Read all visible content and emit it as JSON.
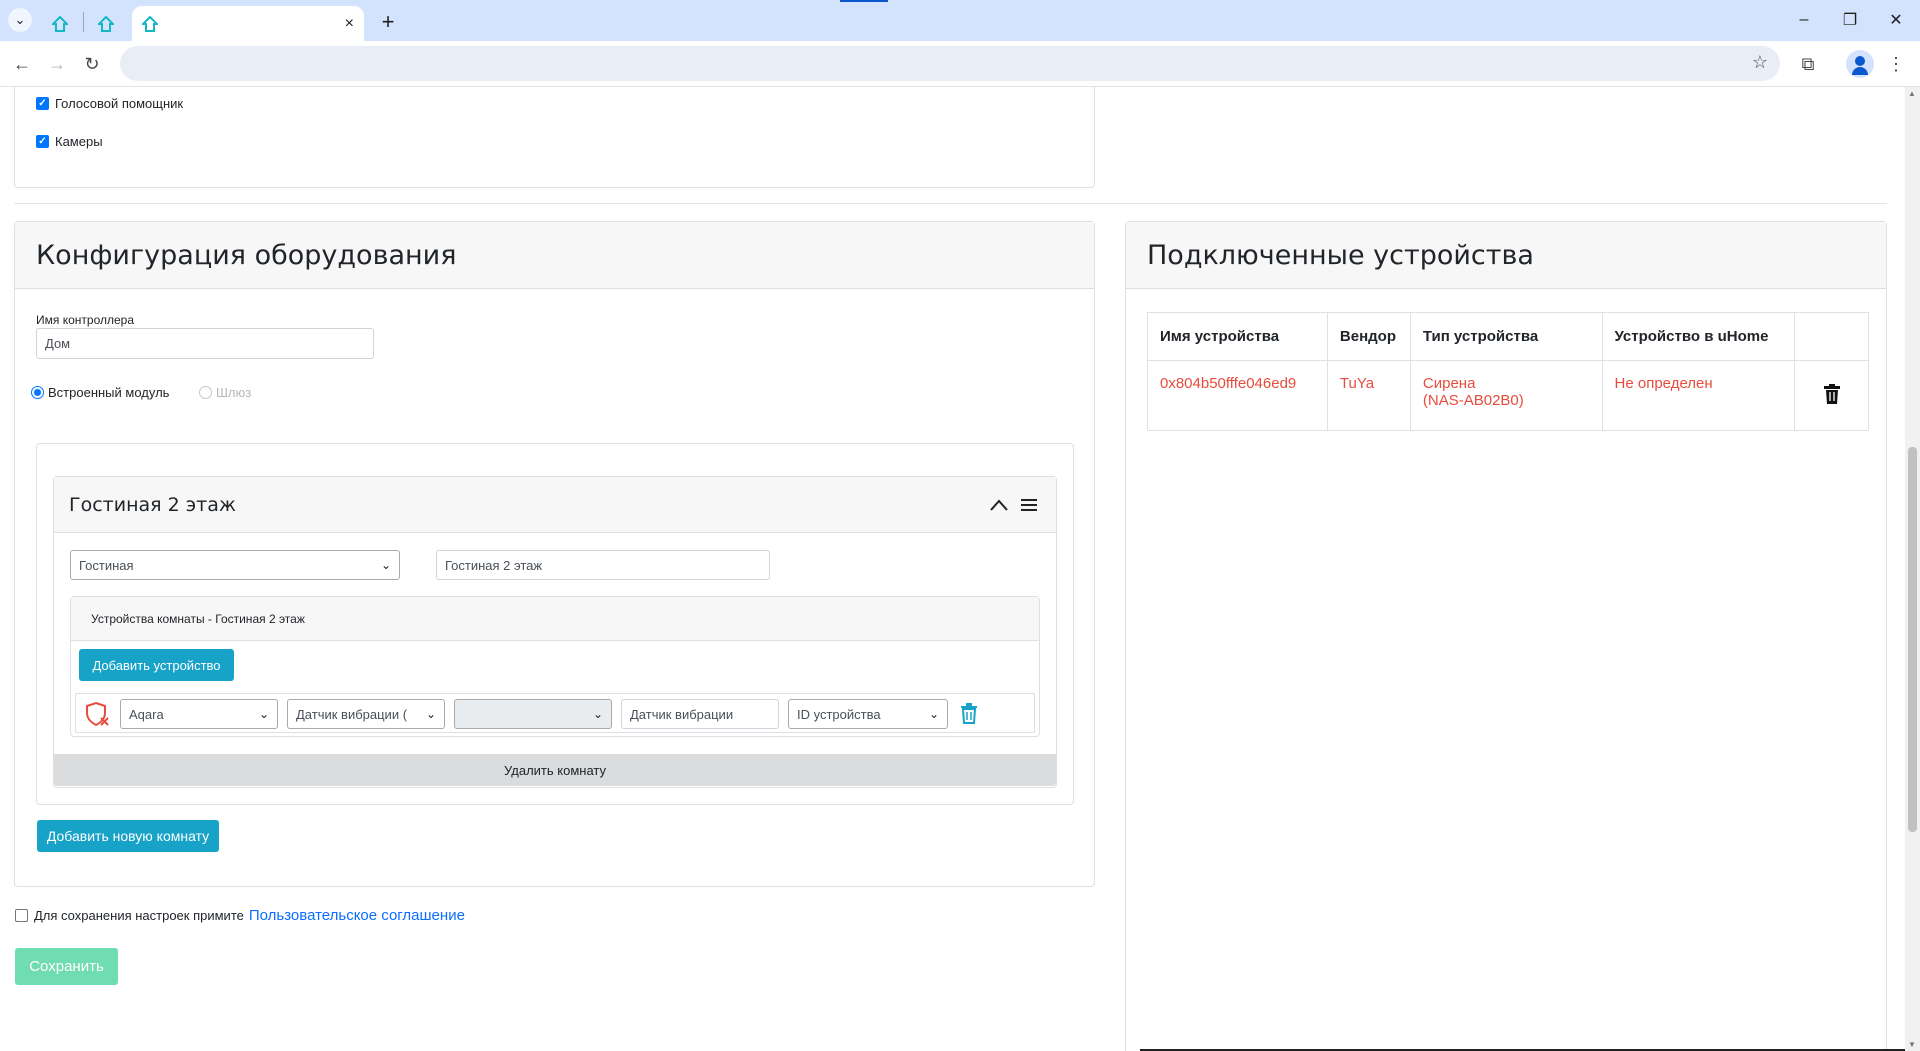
{
  "browser": {
    "active_tab_close": "×",
    "new_tab": "+"
  },
  "config_top": {
    "voice_assistant": "Голосовой помощник",
    "cameras": "Камеры"
  },
  "hardware": {
    "title": "Конфигурация оборудования",
    "controller_name_label": "Имя контроллера",
    "controller_name_value": "Дом",
    "radio_builtin": "Встроенный модуль",
    "radio_gateway": "Шлюз",
    "room": {
      "title": "Гостиная 2 этаж",
      "type_select": "Гостиная",
      "name_input": "Гостиная 2 этаж",
      "devices_header": "Устройства комнаты - Гостиная 2 этаж",
      "add_device": "Добавить устройство",
      "device_row": {
        "vendor": "Aqara",
        "type": "Датчик вибрации (",
        "model": "",
        "name": "Датчик вибрации",
        "device_id": "ID устройства"
      },
      "delete_room": "Удалить комнату"
    },
    "add_room": "Добавить новую комнату"
  },
  "agreement": {
    "text": "Для сохранения настроек примите",
    "link": "Пользовательское соглашение"
  },
  "save": "Сохранить",
  "connected": {
    "title": "Подключенные устройства",
    "columns": [
      "Имя устройства",
      "Вендор",
      "Тип устройства",
      "Устройство в uHome",
      ""
    ],
    "rows": [
      {
        "name": "0x804b50fffe046ed9",
        "vendor": "TuYa",
        "type_line1": "Сирена",
        "type_line2": "(NAS-AB02B0)",
        "uhome": "Не определен"
      }
    ]
  },
  "colors": {
    "accent": "#17a2c8",
    "link": "#0d6efd",
    "error_text": "#e74c3c",
    "save_disabled": "#6fdcb1"
  }
}
